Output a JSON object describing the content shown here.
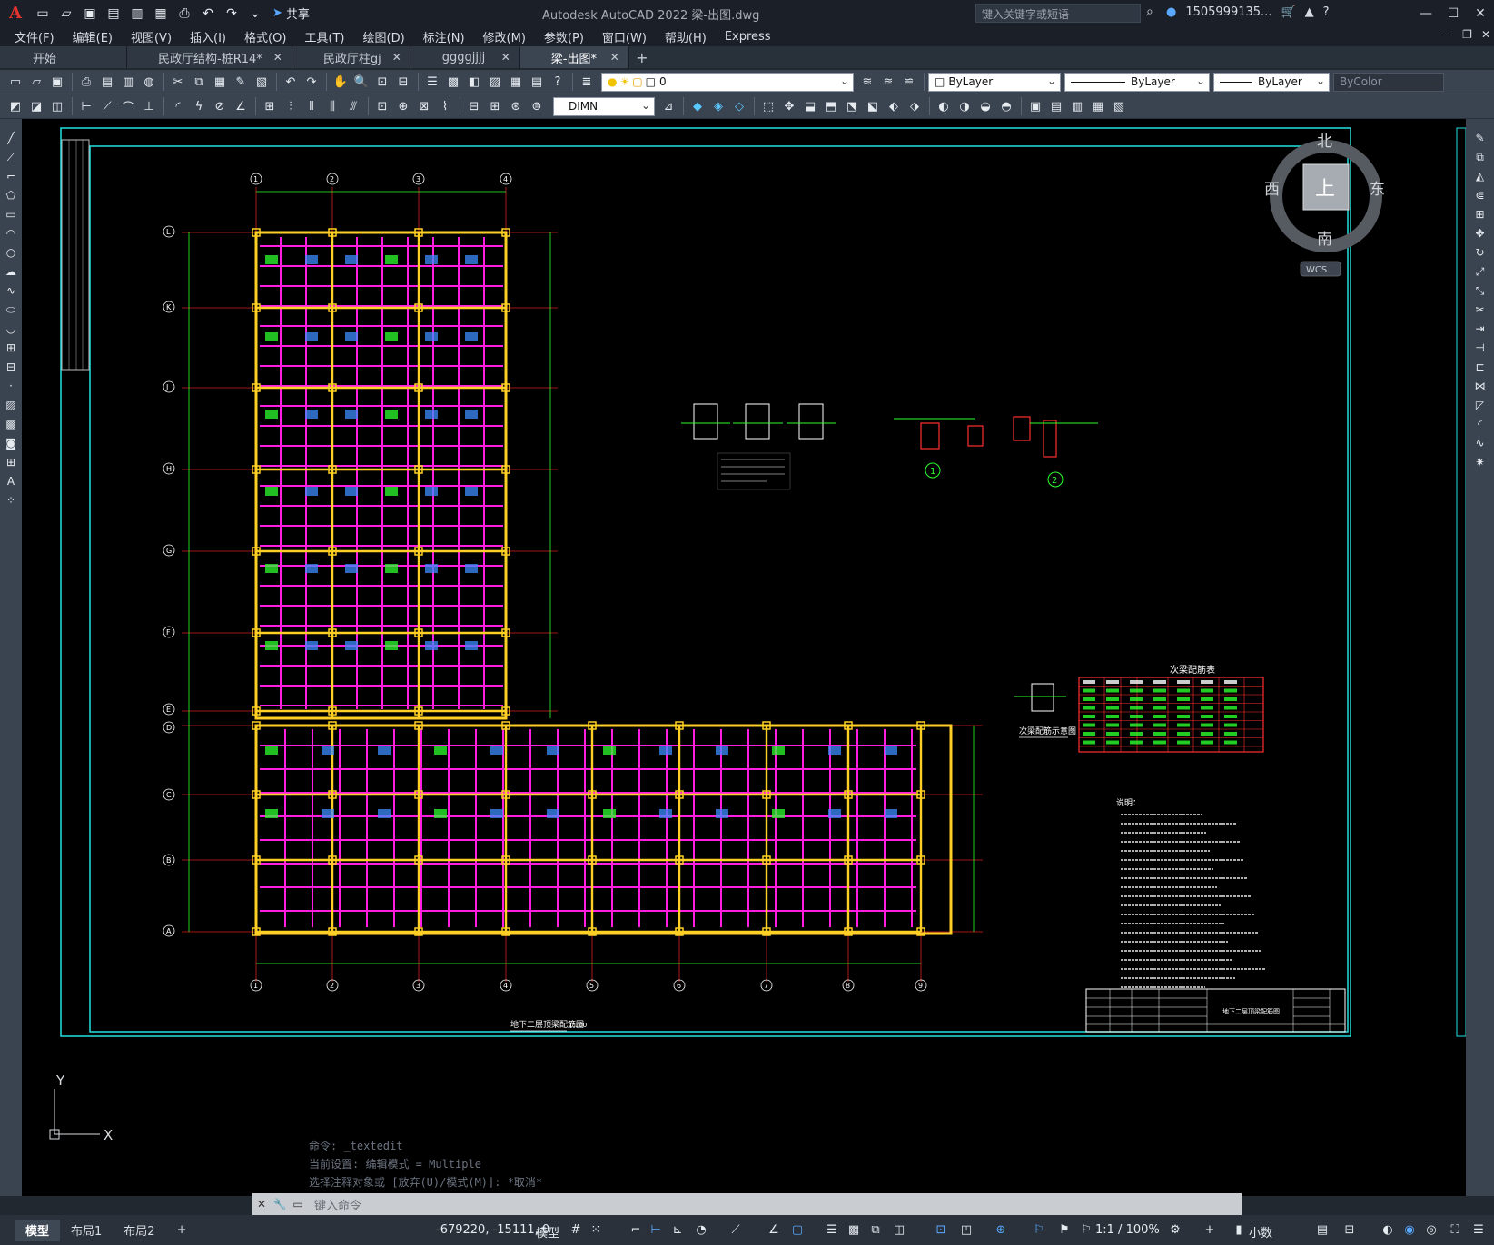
{
  "app": {
    "title": "Autodesk AutoCAD 2022    梁-出图.dwg",
    "logo": "A",
    "share_label": "共享",
    "search_placeholder": "键入关键字或短语",
    "user_name": "1505999135...",
    "help_label": "?"
  },
  "menu": [
    "文件(F)",
    "编辑(E)",
    "视图(V)",
    "插入(I)",
    "格式(O)",
    "工具(T)",
    "绘图(D)",
    "标注(N)",
    "修改(M)",
    "参数(P)",
    "窗口(W)",
    "帮助(H)",
    "Express"
  ],
  "tabs": [
    {
      "label": "开始",
      "closable": false
    },
    {
      "label": "民政厅结构-桩R14*",
      "closable": true
    },
    {
      "label": "民政厅柱gj",
      "closable": true
    },
    {
      "label": "ggggjjjj",
      "closable": true
    },
    {
      "label": "梁-出图*",
      "closable": true,
      "active": true
    }
  ],
  "toolbar1": {
    "layer_value": "0",
    "color_value": "ByLayer",
    "linetype_value": "ByLayer",
    "lineweight_value": "ByLayer",
    "plotstyle_value": "ByColor"
  },
  "toolbar2": {
    "dimstyle_value": "DIMN"
  },
  "viewcube": {
    "north": "北",
    "south": "南",
    "east": "东",
    "west": "西",
    "top_face": "上",
    "wcs": "WCS"
  },
  "ucs": {
    "x": "X",
    "y": "Y"
  },
  "drawing": {
    "grid_top": [
      "1",
      "2",
      "3",
      "4"
    ],
    "grid_bottom": [
      "1",
      "2",
      "3",
      "4",
      "5",
      "6",
      "7",
      "8",
      "9"
    ],
    "grid_left": [
      "L",
      "K",
      "J",
      "H",
      "G",
      "F",
      "E",
      "D",
      "C",
      "B",
      "A"
    ],
    "main_title": "地下二层顶梁配筋图",
    "main_scale": "1:100",
    "section_title": "次梁配筋示意图",
    "table_title": "次梁配筋表",
    "detail1_label": "1",
    "detail2_label": "2",
    "notes_title": "说明：",
    "titleblock_name": "地下二层顶梁配筋图"
  },
  "command": {
    "history": [
      "命令: _textedit",
      "当前设置: 编辑模式 = Multiple",
      "选择注释对象或 [放弃(U)/模式(M)]: *取消*"
    ],
    "placeholder": "键入命令"
  },
  "status": {
    "layout_tabs": [
      "模型",
      "布局1",
      "布局2"
    ],
    "coords": "-679220, -15111, 0",
    "model_label": "模型",
    "scale_label": "1:1 / 100%",
    "units_label": "小数"
  },
  "colors": {
    "grid_line": "#d61e1e",
    "beam_magenta": "#ff1ee0",
    "beam_yellow": "#ffcf25",
    "text_green": "#2cff2c",
    "text_blue": "#3c8cff",
    "frame_cyan": "#22e0e0"
  }
}
